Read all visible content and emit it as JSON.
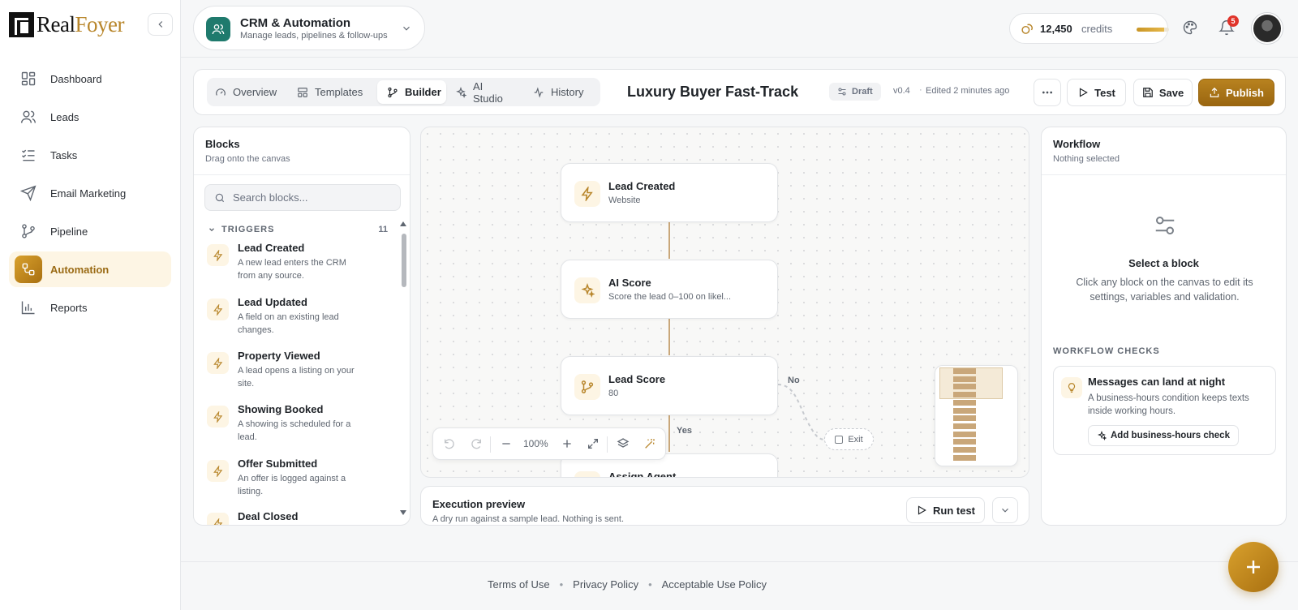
{
  "brand": {
    "name_part1": "Real",
    "name_part2": "Foyer"
  },
  "sidebar": {
    "items": [
      {
        "label": "Dashboard",
        "icon": "grid-icon",
        "active": false
      },
      {
        "label": "Leads",
        "icon": "users-icon",
        "active": false
      },
      {
        "label": "Tasks",
        "icon": "checklist-icon",
        "active": false
      },
      {
        "label": "Email Marketing",
        "icon": "send-icon",
        "active": false
      },
      {
        "label": "Pipeline",
        "icon": "branch-icon",
        "active": false
      },
      {
        "label": "Automation",
        "icon": "automation-icon",
        "active": true
      },
      {
        "label": "Reports",
        "icon": "bar-chart-icon",
        "active": false
      }
    ]
  },
  "topbar": {
    "module_title": "CRM & Automation",
    "module_subtitle": "Manage leads, pipelines & follow-ups",
    "credits_amount": "12,450",
    "credits_label": "credits",
    "credits_fraction": 0.85,
    "notification_count": "5"
  },
  "editor": {
    "tabs": [
      {
        "label": "Overview",
        "icon": "gauge-icon",
        "active": false
      },
      {
        "label": "Templates",
        "icon": "templates-icon",
        "active": false
      },
      {
        "label": "Builder",
        "icon": "branch-icon",
        "active": true
      },
      {
        "label": "AI Studio",
        "icon": "sparkles-icon",
        "active": false
      },
      {
        "label": "History",
        "icon": "activity-icon",
        "active": false
      }
    ],
    "workflow_title": "Luxury Buyer Fast-Track",
    "status": "Draft",
    "version": "v0.4",
    "edited": "Edited 2 minutes ago",
    "test_label": "Test",
    "save_label": "Save",
    "publish_label": "Publish"
  },
  "blocks": {
    "title": "Blocks",
    "subtitle": "Drag onto the canvas",
    "search_placeholder": "Search blocks...",
    "section_label": "TRIGGERS",
    "section_count": "11",
    "items": [
      {
        "title": "Lead Created",
        "desc": "A new lead enters the CRM from any source."
      },
      {
        "title": "Lead Updated",
        "desc": "A field on an existing lead changes."
      },
      {
        "title": "Property Viewed",
        "desc": "A lead opens a listing on your site."
      },
      {
        "title": "Showing Booked",
        "desc": "A showing is scheduled for a lead."
      },
      {
        "title": "Offer Submitted",
        "desc": "An offer is logged against a listing."
      },
      {
        "title": "Deal Closed",
        "desc": ""
      }
    ]
  },
  "canvas": {
    "nodes": [
      {
        "title": "Lead Created",
        "subtitle": "Website",
        "icon": "bolt-icon"
      },
      {
        "title": "AI Score",
        "subtitle": "Score the lead 0–100 on likel...",
        "icon": "sparkles-icon"
      },
      {
        "title": "Lead Score",
        "subtitle": "80",
        "icon": "branch-icon"
      },
      {
        "title": "Assign Agent",
        "subtitle": "",
        "icon": "user-icon"
      }
    ],
    "branch_no": "No",
    "branch_yes": "Yes",
    "exit_label": "Exit",
    "zoom": "100%"
  },
  "execution": {
    "title": "Execution preview",
    "subtitle": "A dry run against a sample lead. Nothing is sent.",
    "run_label": "Run test"
  },
  "workflow": {
    "title": "Workflow",
    "subtitle": "Nothing selected",
    "empty_title": "Select a block",
    "empty_desc": "Click any block on the canvas to edit its settings, variables and validation.",
    "checks_label": "WORKFLOW CHECKS",
    "check": {
      "title": "Messages can land at night",
      "desc": "A business-hours condition keeps texts inside working hours.",
      "action": "Add business-hours check"
    }
  },
  "footer": {
    "links": [
      "Terms of Use",
      "Privacy Policy",
      "Acceptable Use Policy"
    ]
  },
  "colors": {
    "accent": "#b8862b",
    "accent_dark": "#9a6610",
    "teal": "#1f7a6d",
    "badge": "#e0342b"
  }
}
